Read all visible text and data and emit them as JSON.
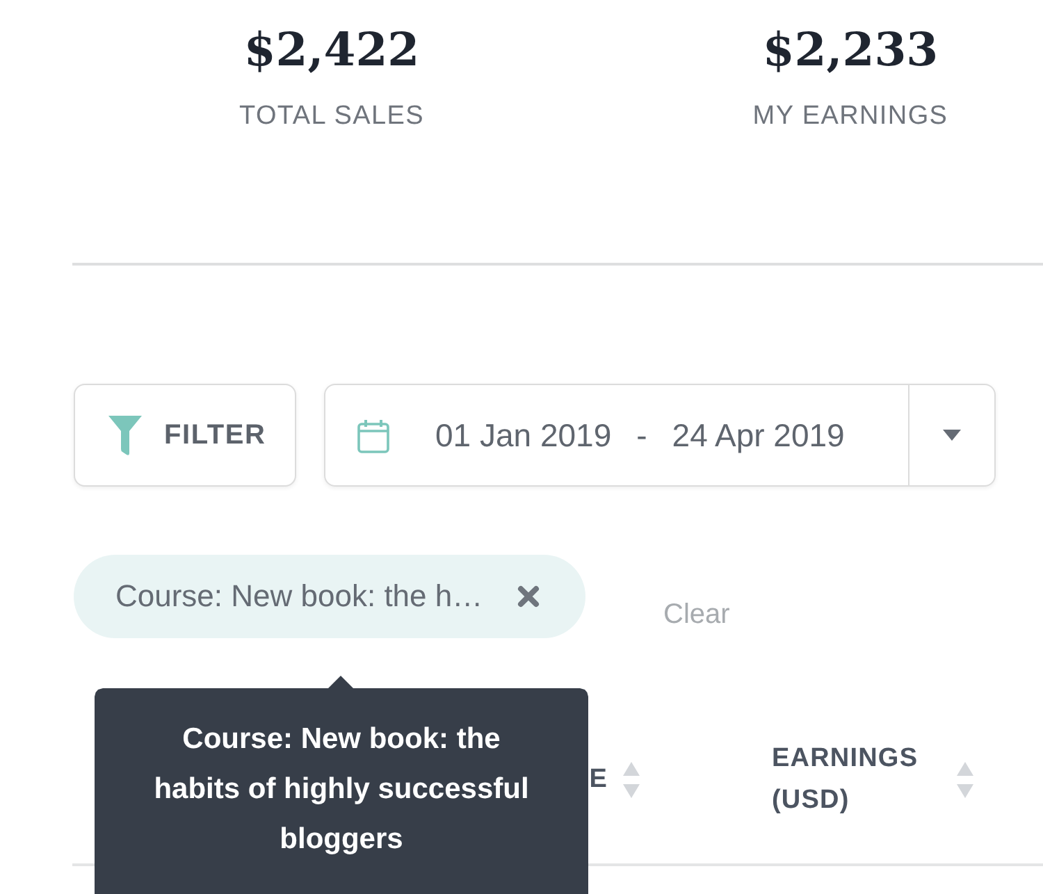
{
  "stats": [
    {
      "value": "$2,422",
      "label": "TOTAL SALES"
    },
    {
      "value": "$2,233",
      "label": "MY EARNINGS"
    }
  ],
  "filter_button": {
    "label": "FILTER"
  },
  "date_range": {
    "start": "01 Jan 2019",
    "separator": "-",
    "end": "24 Apr 2019"
  },
  "active_filters": [
    {
      "label": "Course: New book: the h…"
    }
  ],
  "clear_link": {
    "label": "Clear"
  },
  "table": {
    "columns": [
      {
        "label": "E"
      },
      {
        "label": "EARNINGS (USD)"
      }
    ]
  },
  "tooltip": {
    "text": "Course: New book: the habits of highly successful bloggers"
  }
}
